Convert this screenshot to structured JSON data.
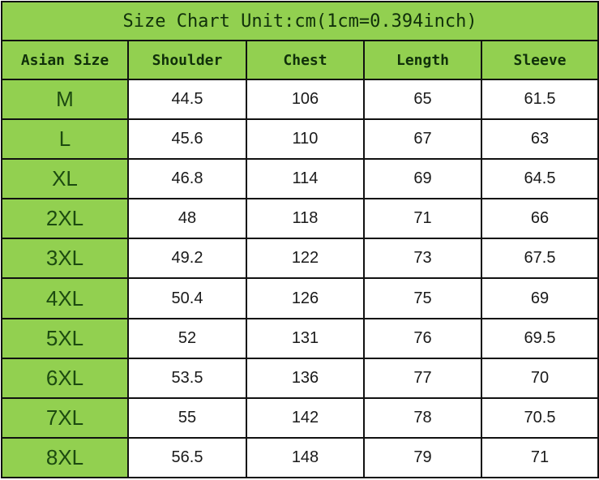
{
  "title": "Size Chart Unit:cm(1cm=0.394inch)",
  "colors": {
    "header_bg": "#92d050",
    "cell_bg": "#ffffff",
    "border": "#111111"
  },
  "columns": [
    "Asian Size",
    "Shoulder",
    "Chest",
    "Length",
    "Sleeve"
  ],
  "rows": [
    [
      "M",
      "44.5",
      "106",
      "65",
      "61.5"
    ],
    [
      "L",
      "45.6",
      "110",
      "67",
      "63"
    ],
    [
      "XL",
      "46.8",
      "114",
      "69",
      "64.5"
    ],
    [
      "2XL",
      "48",
      "118",
      "71",
      "66"
    ],
    [
      "3XL",
      "49.2",
      "122",
      "73",
      "67.5"
    ],
    [
      "4XL",
      "50.4",
      "126",
      "75",
      "69"
    ],
    [
      "5XL",
      "52",
      "131",
      "76",
      "69.5"
    ],
    [
      "6XL",
      "53.5",
      "136",
      "77",
      "70"
    ],
    [
      "7XL",
      "55",
      "142",
      "78",
      "70.5"
    ],
    [
      "8XL",
      "56.5",
      "148",
      "79",
      "71"
    ]
  ]
}
